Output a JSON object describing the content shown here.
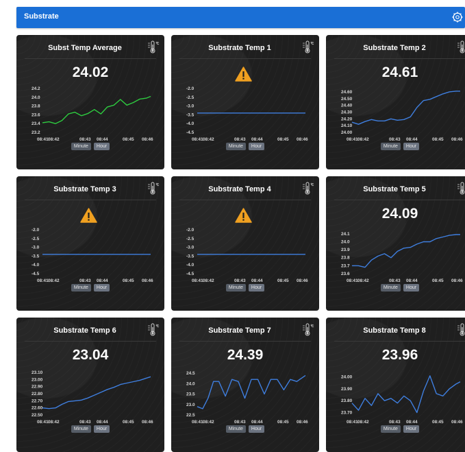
{
  "header": {
    "title": "Substrate"
  },
  "buttons": {
    "minute": "Minute",
    "hour": "Hour"
  },
  "colors": {
    "header": "#1a6fd6",
    "green_line": "#2ecc40",
    "blue_line": "#3f7fe0",
    "warning": "#f0a020"
  },
  "cards": [
    {
      "title": "Subst Temp Average",
      "value": "24.02",
      "chart_data": {
        "type": "line",
        "color": "green",
        "y_ticks": [
          "24.2",
          "24.0",
          "23.8",
          "23.6",
          "23.4",
          "23.2"
        ],
        "ylim": [
          23.2,
          24.2
        ],
        "x_ticks": [
          "08:41",
          "08:42",
          "08:43",
          "08:44",
          "08:45",
          "08:46"
        ],
        "x": [
          0,
          0.3,
          0.6,
          0.9,
          1.2,
          1.5,
          1.8,
          2.1,
          2.4,
          2.7,
          3,
          3.3,
          3.6,
          3.9,
          4.2,
          4.5,
          4.8,
          5
        ],
        "y": [
          23.42,
          23.44,
          23.4,
          23.47,
          23.62,
          23.66,
          23.58,
          23.63,
          23.72,
          23.62,
          23.78,
          23.82,
          23.95,
          23.82,
          23.88,
          23.96,
          23.98,
          24.02
        ]
      }
    },
    {
      "title": "Substrate Temp 1",
      "value": "",
      "chart_data": {
        "type": "line",
        "color": "blue",
        "y_ticks": [
          "-2.0",
          "-2.5",
          "-3.0",
          "-3.5",
          "-4.0",
          "-4.5"
        ],
        "ylim": [
          -4.5,
          -2.0
        ],
        "x_ticks": [
          "08:41",
          "08:42",
          "08:43",
          "08:44",
          "08:45",
          "08:46"
        ],
        "x": [
          0,
          5
        ],
        "y": [
          -3.4,
          -3.4
        ]
      }
    },
    {
      "title": "Substrate Temp 2",
      "value": "24.61",
      "chart_data": {
        "type": "line",
        "color": "blue",
        "y_ticks": [
          "24.60",
          "24.50",
          "24.40",
          "24.30",
          "24.20",
          "24.10",
          "24.00"
        ],
        "ylim": [
          24.0,
          24.65
        ],
        "x_ticks": [
          "08:41",
          "08:42",
          "08:43",
          "08:44",
          "08:45",
          "08:46"
        ],
        "x": [
          0,
          0.3,
          0.6,
          0.9,
          1.2,
          1.5,
          1.8,
          2.1,
          2.4,
          2.7,
          3,
          3.3,
          3.6,
          3.9,
          4.2,
          4.5,
          4.8,
          5
        ],
        "y": [
          24.15,
          24.12,
          24.16,
          24.19,
          24.17,
          24.17,
          24.2,
          24.18,
          24.19,
          24.23,
          24.37,
          24.47,
          24.49,
          24.53,
          24.57,
          24.6,
          24.61,
          24.61
        ]
      }
    },
    {
      "title": "Substrate Temp 3",
      "value": "",
      "chart_data": {
        "type": "line",
        "color": "blue",
        "y_ticks": [
          "-2.0",
          "-2.5",
          "-3.0",
          "-3.5",
          "-4.0",
          "-4.5"
        ],
        "ylim": [
          -4.5,
          -2.0
        ],
        "x_ticks": [
          "08:41",
          "08:42",
          "08:43",
          "08:44",
          "08:45",
          "08:46"
        ],
        "x": [
          0,
          5
        ],
        "y": [
          -3.4,
          -3.4
        ]
      }
    },
    {
      "title": "Substrate Temp 4",
      "value": "",
      "chart_data": {
        "type": "line",
        "color": "blue",
        "y_ticks": [
          "-2.0",
          "-2.5",
          "-3.0",
          "-3.5",
          "-4.0",
          "-4.5"
        ],
        "ylim": [
          -4.5,
          -2.0
        ],
        "x_ticks": [
          "08:41",
          "08:42",
          "08:43",
          "08:44",
          "08:45",
          "08:46"
        ],
        "x": [
          0,
          5
        ],
        "y": [
          -3.4,
          -3.4
        ]
      }
    },
    {
      "title": "Substrate Temp 5",
      "value": "24.09",
      "chart_data": {
        "type": "line",
        "color": "blue",
        "y_ticks": [
          "24.1",
          "24.0",
          "23.9",
          "23.8",
          "23.7",
          "23.6"
        ],
        "ylim": [
          23.6,
          24.15
        ],
        "x_ticks": [
          "08:41",
          "08:42",
          "08:43",
          "08:44",
          "08:45",
          "08:46"
        ],
        "x": [
          0,
          0.3,
          0.6,
          0.9,
          1.2,
          1.5,
          1.8,
          2.1,
          2.4,
          2.7,
          3,
          3.3,
          3.6,
          3.9,
          4.2,
          4.5,
          4.8,
          5
        ],
        "y": [
          23.7,
          23.7,
          23.68,
          23.77,
          23.82,
          23.85,
          23.8,
          23.88,
          23.92,
          23.93,
          23.97,
          24.0,
          24.0,
          24.04,
          24.06,
          24.08,
          24.09,
          24.09
        ]
      }
    },
    {
      "title": "Substrate Temp 6",
      "value": "23.04",
      "chart_data": {
        "type": "line",
        "color": "blue",
        "y_ticks": [
          "23.10",
          "23.00",
          "22.90",
          "22.80",
          "22.70",
          "22.60",
          "22.50"
        ],
        "ylim": [
          22.5,
          23.12
        ],
        "x_ticks": [
          "08:41",
          "08:42",
          "08:43",
          "08:44",
          "08:45",
          "08:46"
        ],
        "x": [
          0,
          0.3,
          0.6,
          0.9,
          1.2,
          1.5,
          1.8,
          2.1,
          2.4,
          2.7,
          3,
          3.3,
          3.6,
          3.9,
          4.2,
          4.5,
          4.8,
          5
        ],
        "y": [
          22.6,
          22.59,
          22.6,
          22.65,
          22.69,
          22.7,
          22.71,
          22.74,
          22.78,
          22.82,
          22.86,
          22.89,
          22.93,
          22.95,
          22.97,
          22.99,
          23.02,
          23.04
        ]
      }
    },
    {
      "title": "Substrate Temp 7",
      "value": "24.39",
      "chart_data": {
        "type": "line",
        "color": "blue",
        "y_ticks": [
          "24.5",
          "24.0",
          "23.5",
          "23.0",
          "22.5"
        ],
        "ylim": [
          22.5,
          24.6
        ],
        "x_ticks": [
          "08:41",
          "08:42",
          "08:43",
          "08:44",
          "08:45",
          "08:46"
        ],
        "x": [
          0,
          0.25,
          0.5,
          0.75,
          1,
          1.3,
          1.6,
          1.9,
          2.2,
          2.5,
          2.8,
          3.1,
          3.4,
          3.7,
          4,
          4.3,
          4.6,
          5
        ],
        "y": [
          22.9,
          22.8,
          23.3,
          24.1,
          24.1,
          23.4,
          24.2,
          24.1,
          23.3,
          24.2,
          24.2,
          23.5,
          24.2,
          24.2,
          23.7,
          24.2,
          24.1,
          24.39
        ]
      }
    },
    {
      "title": "Substrate Temp 8",
      "value": "23.96",
      "chart_data": {
        "type": "line",
        "color": "blue",
        "y_ticks": [
          "24.00",
          "23.90",
          "23.80",
          "23.70"
        ],
        "ylim": [
          23.68,
          24.05
        ],
        "x_ticks": [
          "08:41",
          "08:42",
          "08:43",
          "08:44",
          "08:45",
          "08:46"
        ],
        "x": [
          0,
          0.3,
          0.6,
          0.9,
          1.2,
          1.5,
          1.8,
          2.1,
          2.4,
          2.7,
          3,
          3.3,
          3.6,
          3.9,
          4.2,
          4.5,
          4.8,
          5
        ],
        "y": [
          23.78,
          23.72,
          23.82,
          23.76,
          23.86,
          23.8,
          23.82,
          23.78,
          23.84,
          23.8,
          23.7,
          23.88,
          24.01,
          23.86,
          23.84,
          23.9,
          23.94,
          23.96
        ]
      }
    }
  ]
}
